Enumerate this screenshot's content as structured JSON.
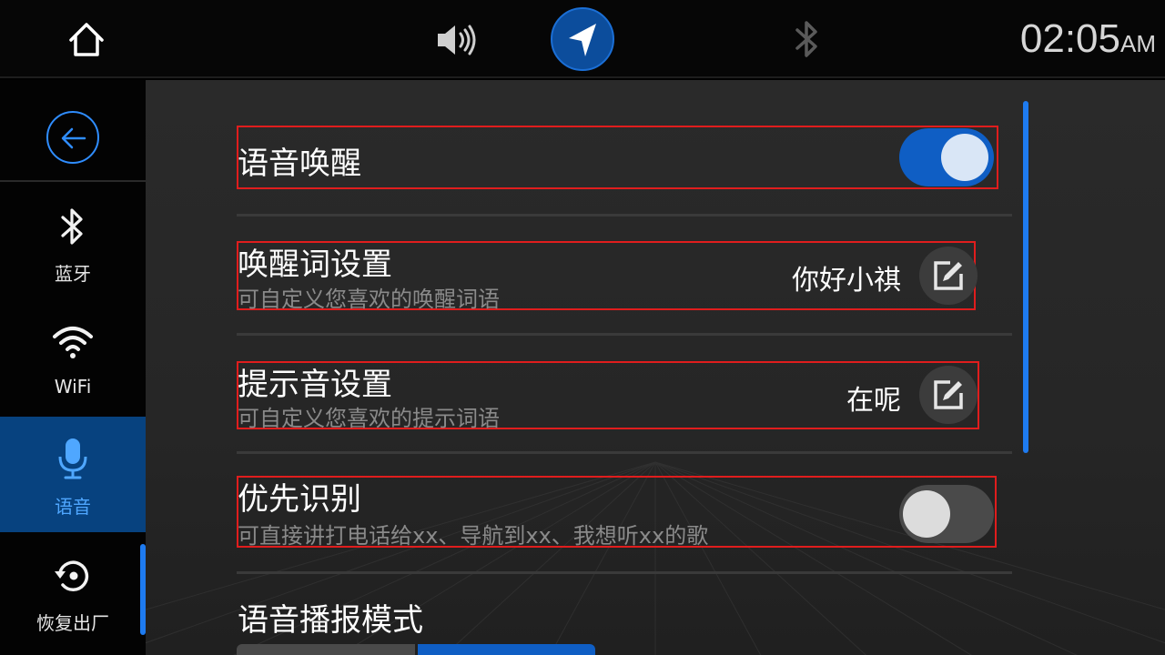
{
  "topbar": {
    "time": "02:05",
    "ampm": "AM",
    "icons": [
      "home-icon",
      "volume-icon",
      "navigation-icon",
      "bluetooth-icon"
    ]
  },
  "sidebar": {
    "back_icon": "back-arrow-icon",
    "items": [
      {
        "label": "蓝牙",
        "icon": "bluetooth-icon",
        "active": false
      },
      {
        "label": "WiFi",
        "icon": "wifi-icon",
        "active": false
      },
      {
        "label": "语音",
        "icon": "microphone-icon",
        "active": true
      },
      {
        "label": "恢复出厂",
        "icon": "factory-reset-icon",
        "active": false
      }
    ],
    "accent": "#07427f"
  },
  "settings": {
    "wake": {
      "title": "语音唤醒",
      "enabled": true
    },
    "wake_word": {
      "title": "唤醒词设置",
      "subtitle": "可自定义您喜欢的唤醒词语",
      "value": "你好小祺"
    },
    "prompt_tone": {
      "title": "提示音设置",
      "subtitle": "可自定义您喜欢的提示词语",
      "value": "在呢"
    },
    "priority": {
      "title": "优先识别",
      "subtitle": "可直接讲打电话给xx、导航到xx、我想听xx的歌",
      "enabled": false
    },
    "broadcast_mode": {
      "title": "语音播报模式"
    }
  },
  "colors": {
    "accent": "#1e7bf0",
    "highlight_border": "#e01d1d",
    "toggle_on": "#0f5ec4",
    "toggle_off": "#4a4a4a"
  }
}
